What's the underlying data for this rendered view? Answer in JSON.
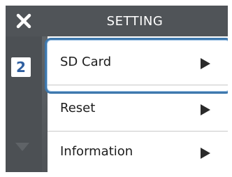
{
  "header": {
    "title": "SETTING",
    "close_icon": "close-icon"
  },
  "sidebar": {
    "page_number": "2",
    "scroll_icon": "chevron-down-icon"
  },
  "menu": {
    "items": [
      {
        "label": "SD Card",
        "icon": "play-arrow-icon",
        "selected": true
      },
      {
        "label": "Reset",
        "icon": "play-arrow-icon",
        "selected": false
      },
      {
        "label": "Information",
        "icon": "play-arrow-icon",
        "selected": false
      }
    ]
  },
  "colors": {
    "accent": "#3e78ad",
    "titlebar": "#505458"
  }
}
